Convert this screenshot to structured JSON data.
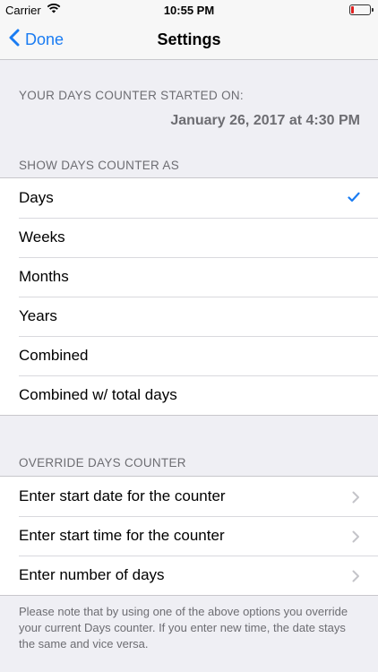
{
  "status": {
    "carrier": "Carrier",
    "time": "10:55 PM",
    "battery_level": 0.15
  },
  "nav": {
    "back_label": "Done",
    "title": "Settings"
  },
  "started": {
    "header": "YOUR DAYS COUNTER STARTED ON:",
    "value": "January 26, 2017 at 4:30 PM"
  },
  "show_as": {
    "header": "SHOW DAYS COUNTER AS",
    "options": [
      {
        "label": "Days",
        "selected": true
      },
      {
        "label": "Weeks",
        "selected": false
      },
      {
        "label": "Months",
        "selected": false
      },
      {
        "label": "Years",
        "selected": false
      },
      {
        "label": "Combined",
        "selected": false
      },
      {
        "label": "Combined w/ total days",
        "selected": false
      }
    ]
  },
  "override": {
    "header": "OVERRIDE DAYS COUNTER",
    "items": [
      {
        "label": "Enter start date for the counter"
      },
      {
        "label": "Enter start time for the counter"
      },
      {
        "label": "Enter number of days"
      }
    ],
    "footnote": "Please note that by using one of the above options you override your current Days counter. If you enter new time, the date stays the same and vice versa."
  },
  "colors": {
    "accent": "#1a7cf2",
    "background": "#efeff4",
    "secondary_text": "#6d6d72",
    "battery_low": "#e02020"
  },
  "icons": {
    "wifi": "wifi-icon",
    "battery": "battery-icon",
    "back": "chevron-left-icon",
    "check": "checkmark-icon",
    "disclosure": "chevron-right-icon"
  }
}
